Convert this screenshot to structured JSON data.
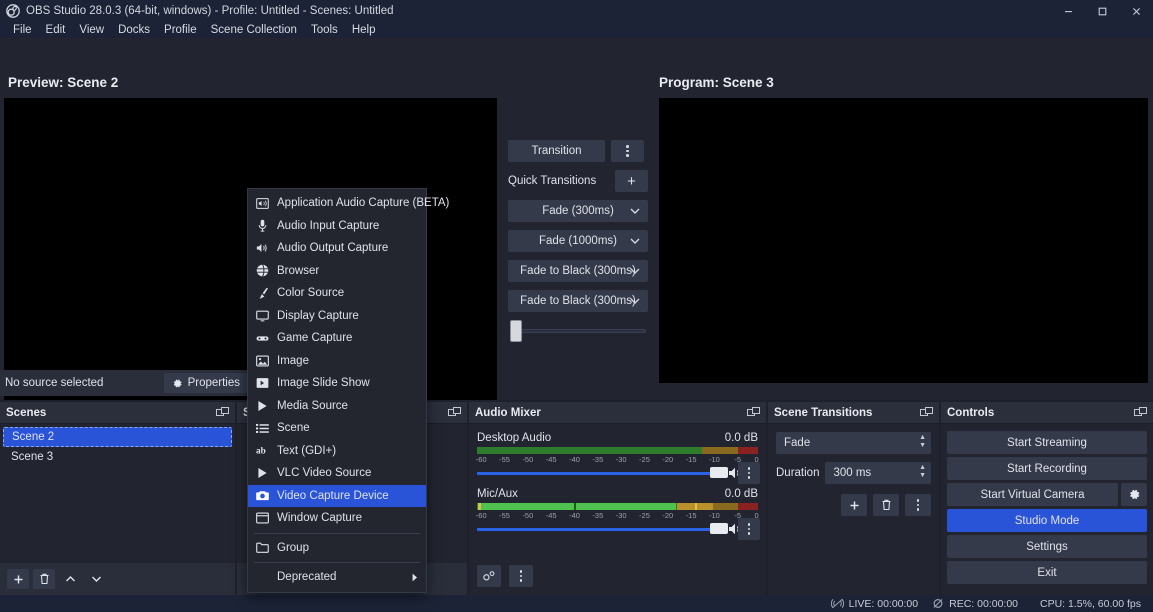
{
  "window": {
    "title": "OBS Studio 28.0.3 (64-bit, windows) - Profile: Untitled - Scenes: Untitled",
    "logo_icon": "obs-logo-icon",
    "minimize_icon": "minimize-icon",
    "maximize_icon": "maximize-icon",
    "close_icon": "close-icon"
  },
  "menubar": {
    "items": [
      {
        "label": "File"
      },
      {
        "label": "Edit"
      },
      {
        "label": "View"
      },
      {
        "label": "Docks"
      },
      {
        "label": "Profile"
      },
      {
        "label": "Scene Collection"
      },
      {
        "label": "Tools"
      },
      {
        "label": "Help"
      }
    ]
  },
  "preview": {
    "label": "Preview: Scene 2"
  },
  "program": {
    "label": "Program: Scene 3"
  },
  "transition_column": {
    "transition_label": "Transition",
    "menu_icon": "kebab-menu-icon",
    "quick_transitions_label": "Quick Transitions",
    "add_label": "+",
    "quick_transitions": [
      {
        "label": "Fade (300ms)"
      },
      {
        "label": "Fade (1000ms)"
      },
      {
        "label": "Fade to Black (300ms)"
      },
      {
        "label": "Fade to Black (300ms)"
      }
    ],
    "t_bar_value": 0
  },
  "source_toolbar": {
    "status": "No source selected",
    "properties_label": "Properties",
    "properties_icon": "gear-icon"
  },
  "scenes_dock": {
    "title": "Scenes",
    "float_icon": "float-dock-icon",
    "items": [
      {
        "label": "Scene 2",
        "selected": true
      },
      {
        "label": "Scene 3",
        "selected": false
      }
    ],
    "tools": [
      {
        "name": "add-scene-button",
        "icon": "plus-icon"
      },
      {
        "name": "remove-scene-button",
        "icon": "trash-icon"
      },
      {
        "name": "move-scene-up-button",
        "icon": "chevron-up-icon"
      },
      {
        "name": "move-scene-down-button",
        "icon": "chevron-down-icon"
      }
    ]
  },
  "sources_dock": {
    "title": "Sources",
    "float_icon": "float-dock-icon"
  },
  "audio_mixer": {
    "title": "Audio Mixer",
    "float_icon": "float-dock-icon",
    "scale_ticks": [
      "-60",
      "-55",
      "-50",
      "-45",
      "-40",
      "-35",
      "-30",
      "-25",
      "-20",
      "-15",
      "-10",
      "-5",
      "0"
    ],
    "channels": [
      {
        "name": "Desktop Audio",
        "db": "0.0 dB",
        "level_pct": 0,
        "volume_pct": 100,
        "mute_icon": "speaker-icon",
        "menu_icon": "kebab-menu-icon"
      },
      {
        "name": "Mic/Aux",
        "db": "0.0 dB",
        "level_pct": 71,
        "volume_pct": 100,
        "mute_icon": "speaker-icon",
        "menu_icon": "kebab-menu-icon"
      }
    ],
    "footer": [
      {
        "name": "advanced-audio-properties-button",
        "icon": "audio-settings-icon"
      },
      {
        "name": "audio-mixer-menu-button",
        "icon": "kebab-menu-icon"
      }
    ]
  },
  "scene_transitions": {
    "title": "Scene Transitions",
    "float_icon": "float-dock-icon",
    "transition_value": "Fade",
    "duration_label": "Duration",
    "duration_value": "300 ms",
    "buttons": [
      {
        "name": "add-transition-button",
        "icon": "plus-icon"
      },
      {
        "name": "remove-transition-button",
        "icon": "trash-icon"
      },
      {
        "name": "transition-properties-button",
        "icon": "kebab-menu-icon"
      }
    ]
  },
  "controls": {
    "title": "Controls",
    "float_icon": "float-dock-icon",
    "start_streaming": "Start Streaming",
    "start_recording": "Start Recording",
    "start_virtual_camera": "Start Virtual Camera",
    "virtual_camera_settings_icon": "gear-icon",
    "studio_mode": "Studio Mode",
    "studio_mode_active": true,
    "settings": "Settings",
    "exit": "Exit"
  },
  "statusbar": {
    "live_icon": "broadcast-off-icon",
    "live": "LIVE: 00:00:00",
    "rec_icon": "record-off-icon",
    "rec": "REC: 00:00:00",
    "cpu": "CPU: 1.5%, 60.00 fps"
  },
  "context_menu": {
    "items": [
      {
        "label": "Application Audio Capture (BETA)",
        "icon": "app-audio-icon",
        "selected": false
      },
      {
        "label": "Audio Input Capture",
        "icon": "microphone-icon",
        "selected": false
      },
      {
        "label": "Audio Output Capture",
        "icon": "speaker-icon",
        "selected": false
      },
      {
        "label": "Browser",
        "icon": "browser-icon",
        "selected": false
      },
      {
        "label": "Color Source",
        "icon": "brush-icon",
        "selected": false
      },
      {
        "label": "Display Capture",
        "icon": "monitor-icon",
        "selected": false
      },
      {
        "label": "Game Capture",
        "icon": "gamepad-icon",
        "selected": false
      },
      {
        "label": "Image",
        "icon": "image-icon",
        "selected": false
      },
      {
        "label": "Image Slide Show",
        "icon": "slideshow-icon",
        "selected": false
      },
      {
        "label": "Media Source",
        "icon": "play-icon",
        "selected": false
      },
      {
        "label": "Scene",
        "icon": "list-icon",
        "selected": false
      },
      {
        "label": "Text (GDI+)",
        "icon": "text-icon",
        "selected": false
      },
      {
        "label": "VLC Video Source",
        "icon": "play-icon",
        "selected": false
      },
      {
        "label": "Video Capture Device",
        "icon": "camera-icon",
        "selected": true
      },
      {
        "label": "Window Capture",
        "icon": "window-icon",
        "selected": false
      },
      {
        "separator_before": true,
        "label": "Group",
        "icon": "folder-icon",
        "selected": false
      },
      {
        "separator_before": true,
        "label": "Deprecated",
        "icon": "",
        "submenu": true,
        "selected": false
      }
    ]
  }
}
